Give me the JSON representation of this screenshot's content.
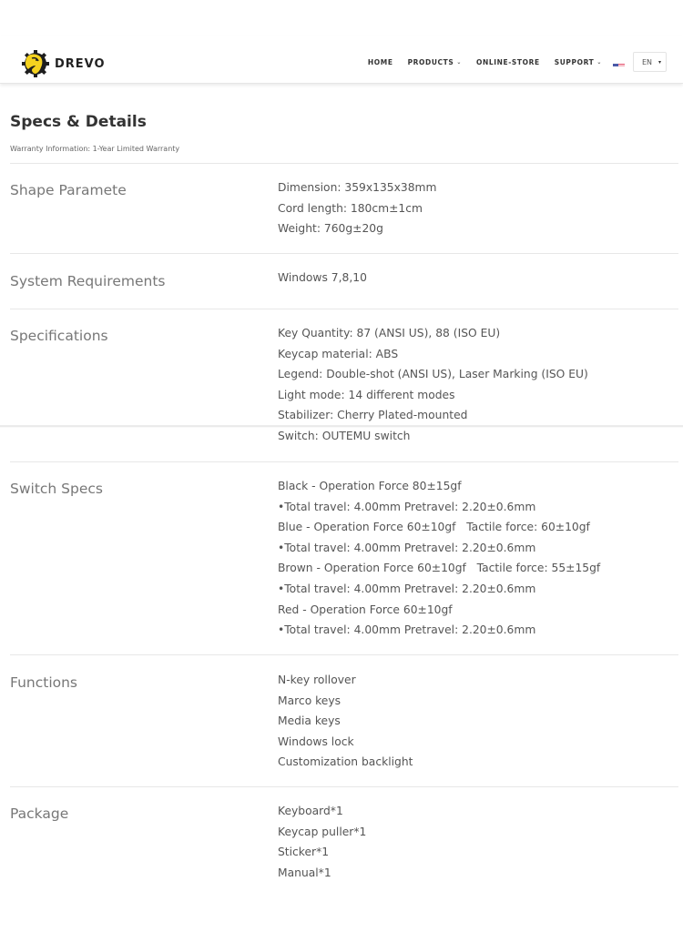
{
  "header": {
    "brand": "DREVO",
    "logo_icon": "drevo-horse-gear-logo",
    "nav": [
      {
        "label": "HOME",
        "has_dropdown": false
      },
      {
        "label": "PRODUCTS",
        "has_dropdown": true
      },
      {
        "label": "ONLINE-STORE",
        "has_dropdown": false
      },
      {
        "label": "SUPPORT",
        "has_dropdown": true
      }
    ],
    "flag_icon": "us-flag-icon",
    "language": {
      "selected": "EN",
      "caret": "▾"
    },
    "chevron": "⌄"
  },
  "specs": {
    "title": "Specs & Details",
    "warranty": "Warranty Information: 1-Year Limited Warranty",
    "rows": [
      {
        "label": "Shape Paramete",
        "values": [
          "Dimension: 359x135x38mm",
          "Cord length: 180cm±1cm",
          "Weight: 760g±20g"
        ]
      },
      {
        "label": "System Requirements",
        "values": [
          "Windows 7,8,10"
        ]
      },
      {
        "label": "Specifications",
        "values": [
          "Key Quantity: 87 (ANSI US), 88 (ISO EU)",
          "Keycap material: ABS",
          "Legend: Double-shot (ANSI US), Laser Marking (ISO EU)",
          "Light mode: 14 different modes",
          "Stabilizer: Cherry Plated-mounted",
          "Switch: OUTEMU switch"
        ]
      },
      {
        "label": "Switch Specs",
        "values": [
          "Black - Operation Force 80±15gf",
          "•Total travel: 4.00mm Pretravel: 2.20±0.6mm",
          "Blue - Operation Force 60±10gf   Tactile force: 60±10gf",
          "•Total travel: 4.00mm Pretravel: 2.20±0.6mm",
          "Brown - Operation Force 60±10gf   Tactile force: 55±15gf",
          "•Total travel: 4.00mm Pretravel: 2.20±0.6mm",
          "Red - Operation Force 60±10gf",
          "•Total travel: 4.00mm Pretravel: 2.20±0.6mm"
        ]
      },
      {
        "label": "Functions",
        "values": [
          "N-key rollover",
          "Marco keys",
          "Media keys",
          "Windows lock",
          "Customization backlight"
        ]
      },
      {
        "label": "Package",
        "values": [
          "Keyboard*1",
          "Keycap puller*1",
          "Sticker*1",
          "Manual*1"
        ]
      }
    ]
  },
  "colors": {
    "logo_yellow": "#f5d21f",
    "logo_dark": "#1e1e1e",
    "text_dark": "#333333",
    "text_body": "#555555",
    "label_gray": "#777777",
    "divider": "#e7e7e7"
  }
}
